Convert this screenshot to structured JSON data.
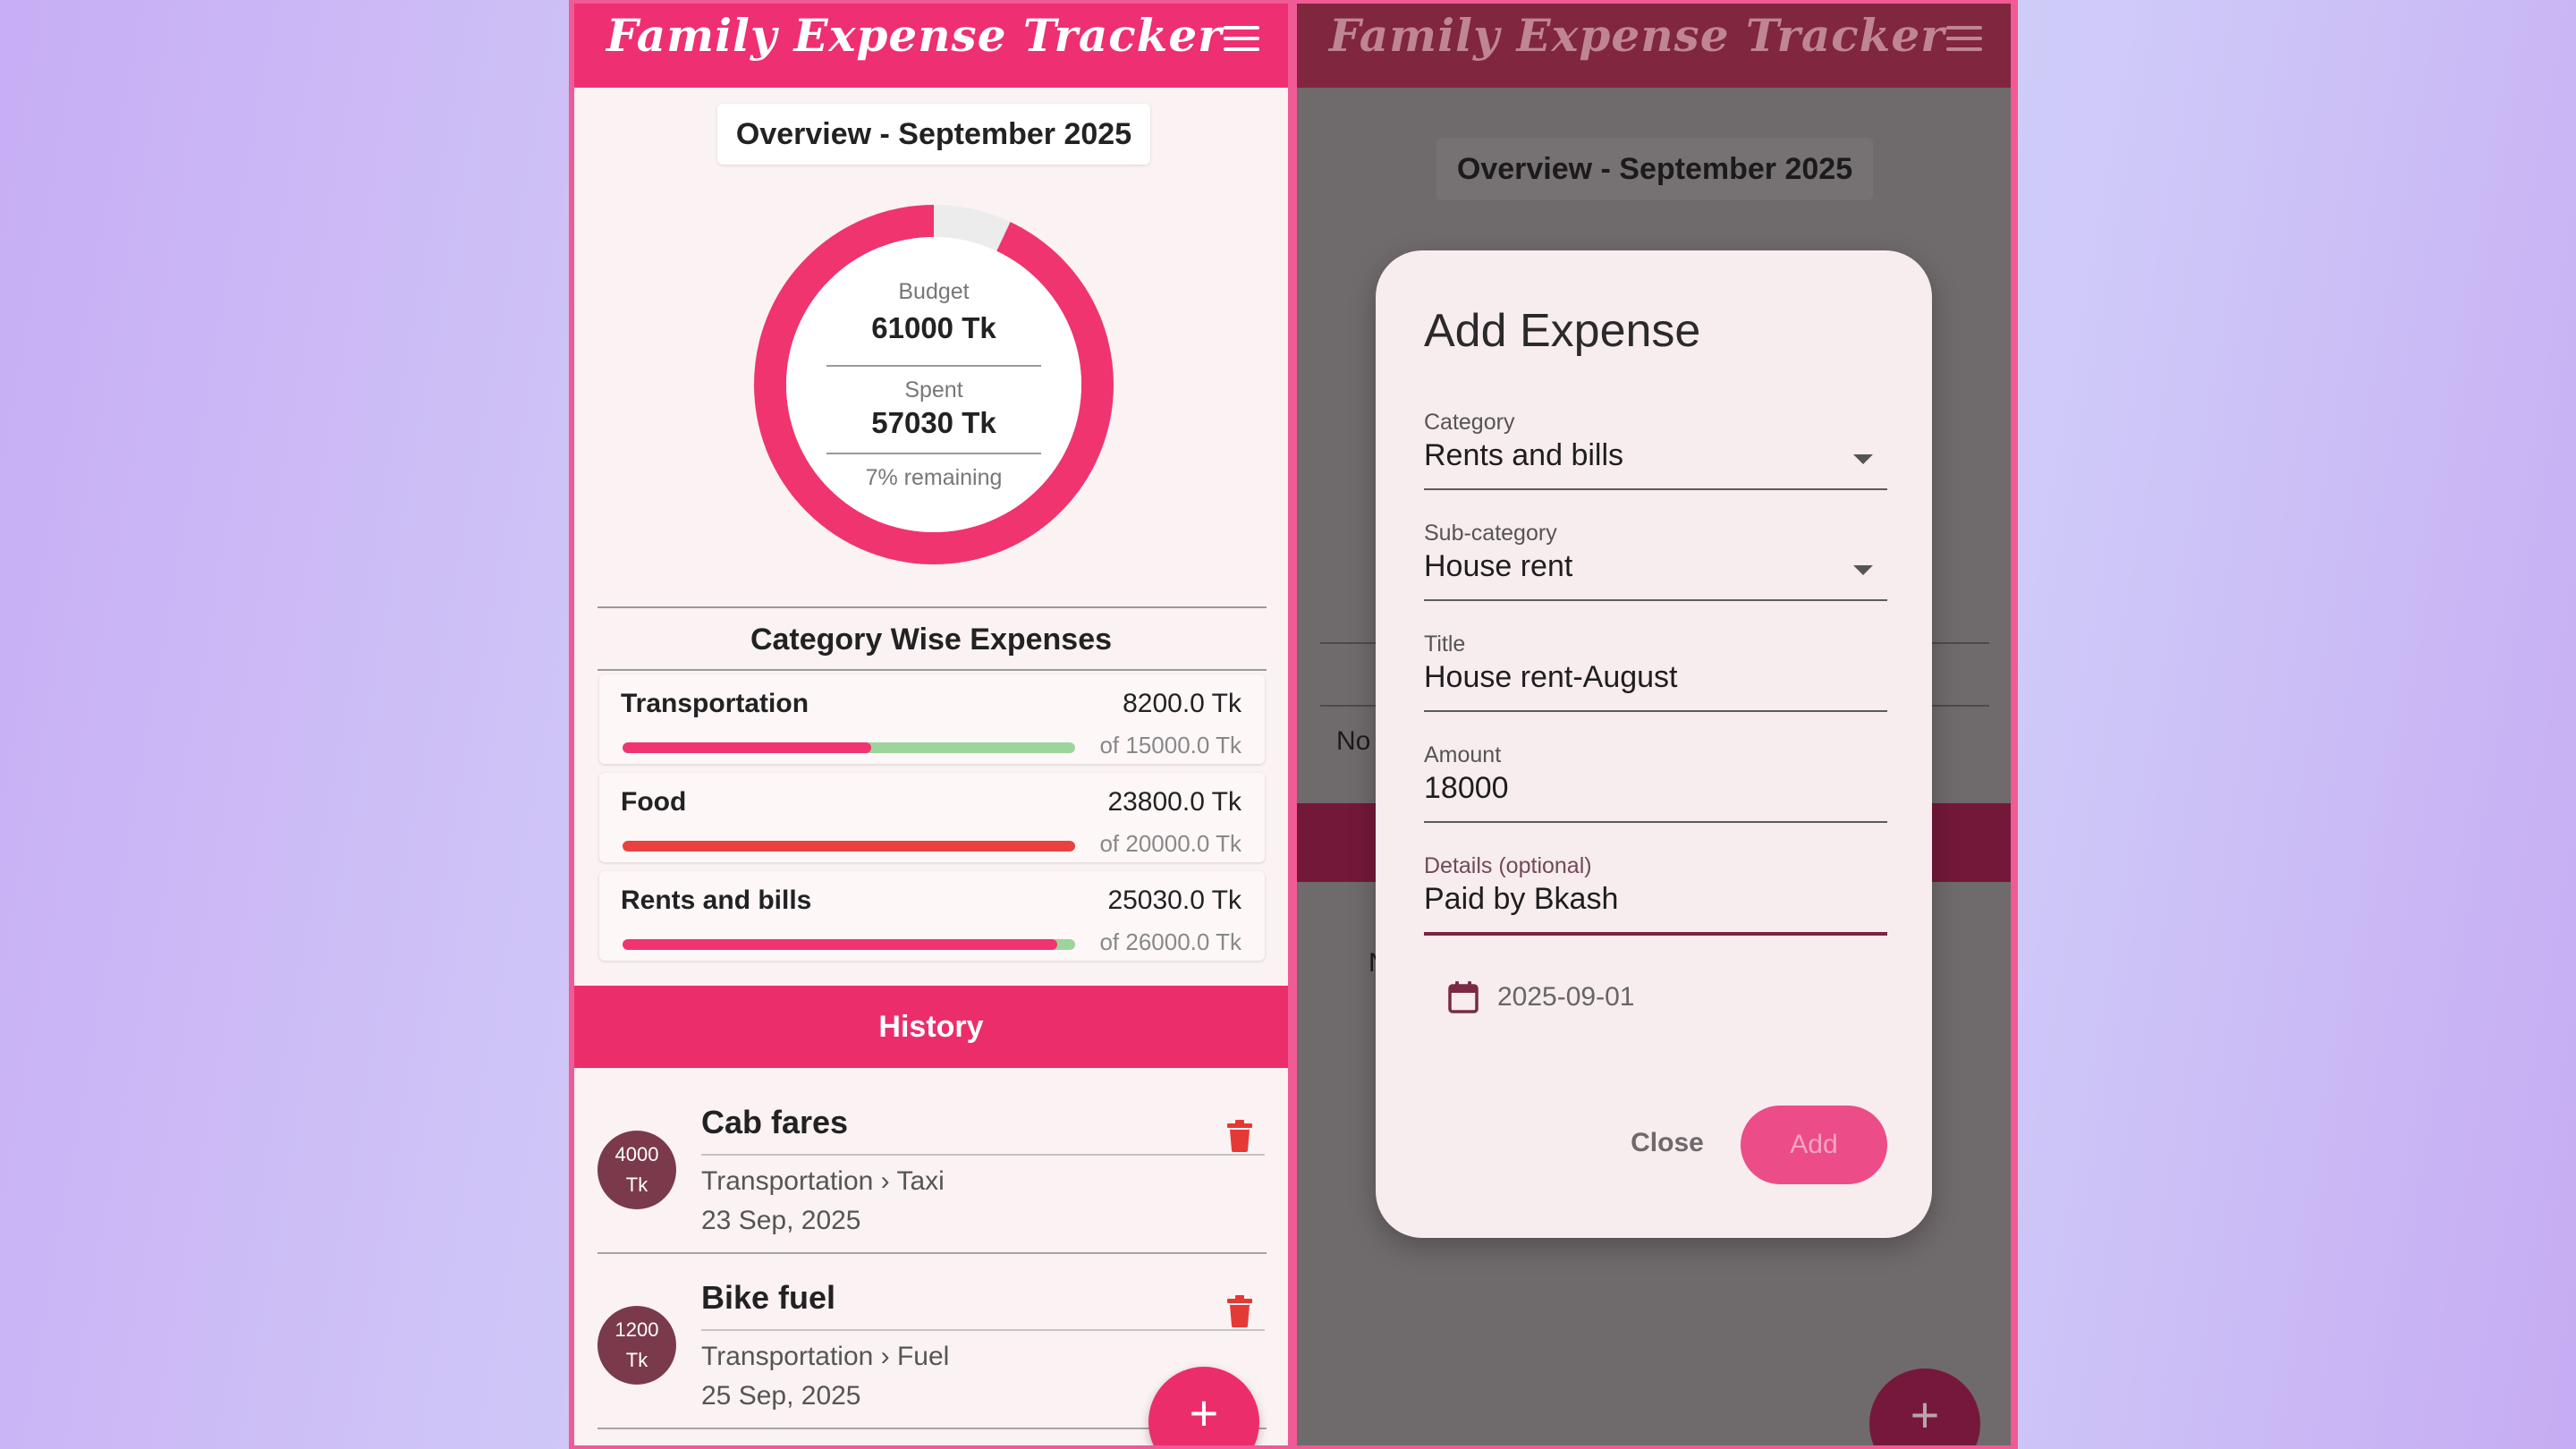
{
  "app": {
    "title": "Family Expense Tracker"
  },
  "overview": {
    "title": "Overview - September 2025",
    "budget_label": "Budget",
    "budget_value": "61000 Tk",
    "spent_label": "Spent",
    "spent_value": "57030 Tk",
    "remaining": "7% remaining",
    "spent_fraction": 0.93
  },
  "category_section": {
    "title": "Category Wise Expenses",
    "items": [
      {
        "name": "Transportation",
        "amount": "8200.0 Tk",
        "of": "of 15000.0 Tk",
        "fraction": 0.55,
        "bar_color": "#f0346f"
      },
      {
        "name": "Food",
        "amount": "23800.0 Tk",
        "of": "of 20000.0 Tk",
        "fraction": 1.0,
        "bar_color": "#ea4040"
      },
      {
        "name": "Rents and bills",
        "amount": "25030.0 Tk",
        "of": "of 26000.0 Tk",
        "fraction": 0.96,
        "bar_color": "#f0346f"
      }
    ]
  },
  "history": {
    "title": "History",
    "items": [
      {
        "avatar_line1": "4000",
        "avatar_line2": "Tk",
        "title": "Cab fares",
        "subtitle": "Transportation › Taxi",
        "date": "23 Sep, 2025"
      },
      {
        "avatar_line1": "1200",
        "avatar_line2": "Tk",
        "title": "Bike fuel",
        "subtitle": "Transportation › Fuel",
        "date": "25 Sep, 2025"
      }
    ]
  },
  "fab": {
    "symbol": "+"
  },
  "background_screen": {
    "no_text": "No",
    "n_text": "N"
  },
  "dialog": {
    "title": "Add Expense",
    "category": {
      "label": "Category",
      "value": "Rents and bills"
    },
    "subcategory": {
      "label": "Sub-category",
      "value": "House rent"
    },
    "title_field": {
      "label": "Title",
      "value": "House rent-August"
    },
    "amount": {
      "label": "Amount",
      "value": "18000"
    },
    "details": {
      "label": "Details (optional)",
      "value": "Paid by Bkash"
    },
    "date": "2025-09-01",
    "close_label": "Close",
    "add_label": "Add"
  },
  "colors": {
    "primary": "#ee2f72",
    "avatar": "#7a3a4c",
    "track_ok": "#9dd49c",
    "delete_icon": "#e53935"
  }
}
